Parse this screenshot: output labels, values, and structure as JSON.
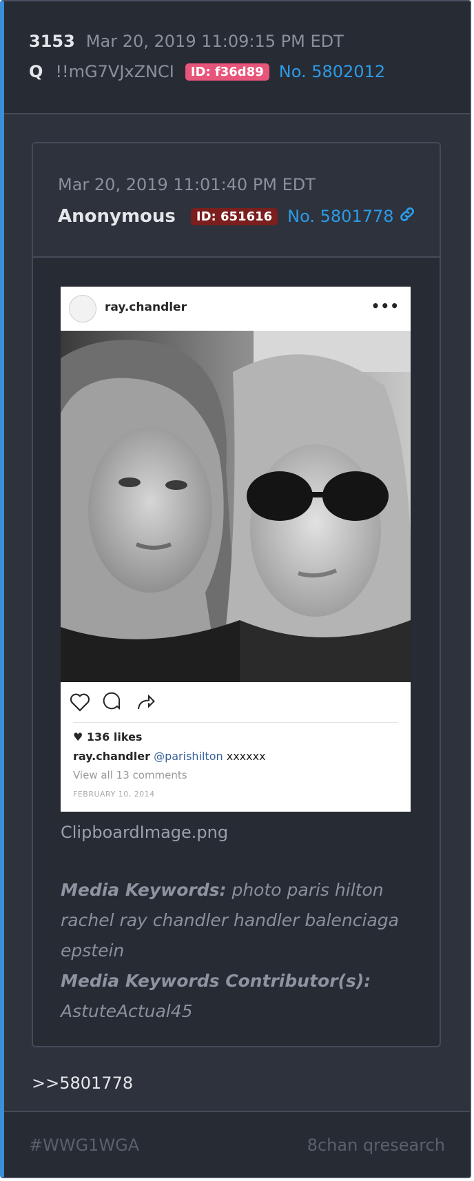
{
  "post": {
    "number": "3153",
    "date": "Mar 20, 2019 11:09:15 PM EDT",
    "author": "Q",
    "tripcode": "!!mG7VJxZNCI",
    "id_badge": "ID: f36d89",
    "post_no": "No. 5802012",
    "reply_text": ">>5801778"
  },
  "quoted_post": {
    "date": "Mar 20, 2019 11:01:40 PM EDT",
    "author": "Anonymous",
    "id_badge": "ID: 651616",
    "post_no": "No. 5801778",
    "link_icon": "link-icon",
    "image": {
      "ig_username": "ray.chandler",
      "ig_more": "•••",
      "likes": "♥ 136 likes",
      "caption_user": "ray.chandler",
      "caption_mention": "@parishilton",
      "caption_text": "xxxxxx",
      "comments": "View all 13 comments",
      "date": "FEBRUARY 10, 2014"
    },
    "filename": "ClipboardImage.png",
    "keywords_label": "Media Keywords:",
    "keywords": "photo paris hilton rachel ray chandler handler balenciaga epstein",
    "contributors_label": "Media Keywords Contributor(s):",
    "contributors": "AstuteActual45"
  },
  "footer": {
    "hashtag": "#WWG1WGA",
    "source": "8chan qresearch"
  },
  "colors": {
    "card_bg": "#2d323c",
    "header_bg": "#272b33",
    "accent_border": "#3b8fd6",
    "link": "#2d9be6",
    "q_id_badge": "#e8557a",
    "anon_id_badge": "#7a1e1e"
  }
}
